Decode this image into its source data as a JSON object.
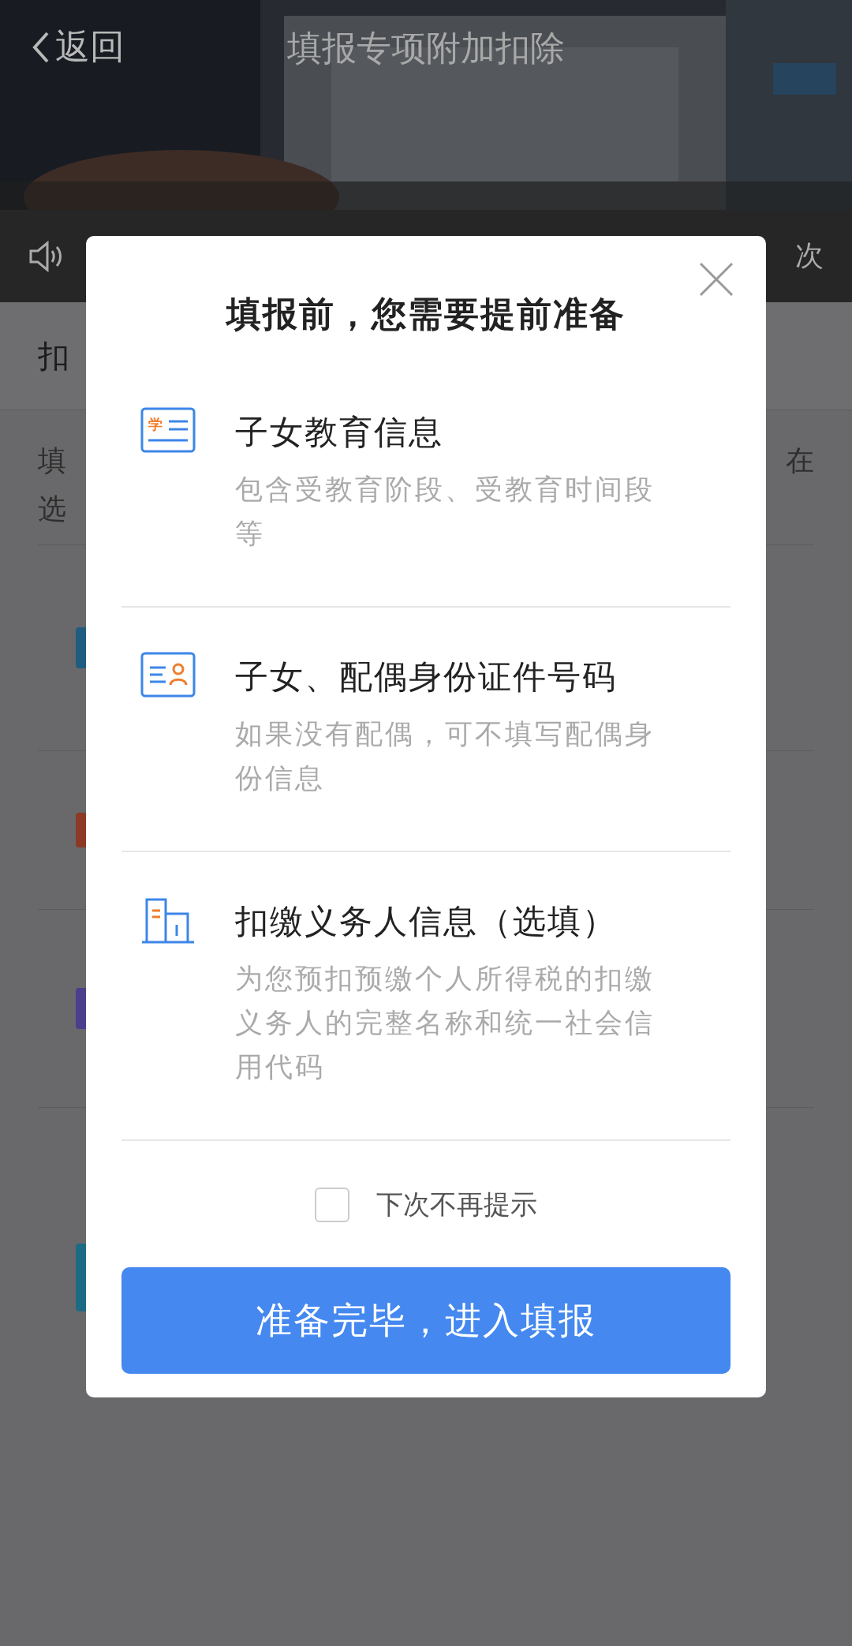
{
  "header": {
    "back": "返回",
    "title": "填报专项附加扣除"
  },
  "notice_bar": {
    "tail": "次"
  },
  "section_title": "扣",
  "intro": {
    "line_1_start": "填",
    "line_2_start": "选",
    "line_1_end": "在"
  },
  "list_icons": [
    {
      "color": "#1f5c80"
    },
    {
      "color": "#8c3a25"
    },
    {
      "color": "#4a3f8a"
    },
    {
      "color": "#1d6a85"
    }
  ],
  "modal": {
    "title": "填报前，您需要提前准备",
    "items": [
      {
        "kind": "education",
        "badge": "学",
        "title": "子女教育信息",
        "desc": "包含受教育阶段、受教育时间段等"
      },
      {
        "kind": "id_card",
        "title": "子女、配偶身份证件号码",
        "desc": "如果没有配偶，可不填写配偶身份信息"
      },
      {
        "kind": "building",
        "title": "扣缴义务人信息（选填）",
        "desc": "为您预扣预缴个人所得税的扣缴义务人的完整名称和统一社会信用代码"
      }
    ],
    "dont_remind": {
      "label": "下次不再提示",
      "checked": false
    },
    "confirm": "准备完毕，进入填报"
  }
}
